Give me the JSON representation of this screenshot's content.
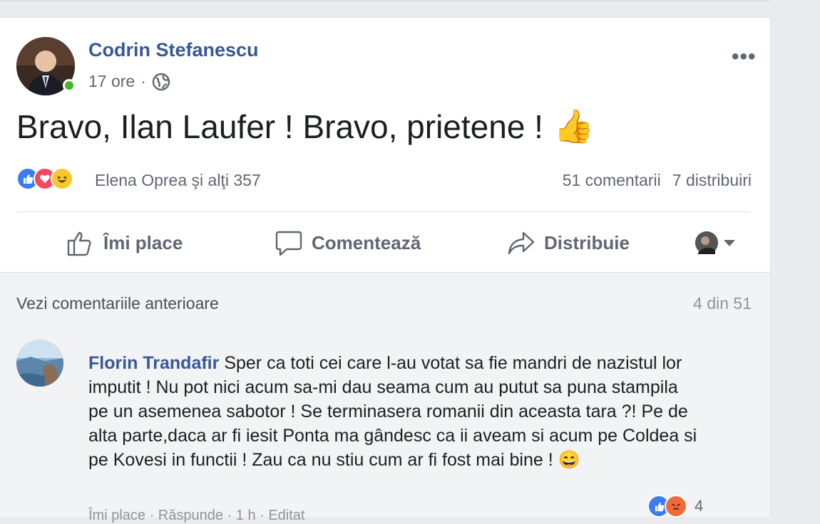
{
  "post": {
    "author": "Codrin Stefanescu",
    "time": "17 ore",
    "separator": "·",
    "text": "Bravo, Ilan Laufer ! Bravo, prietene !",
    "emoji": "👍",
    "more_label": "•••",
    "reactions": {
      "summary": "Elena Oprea şi alţi 357",
      "types": [
        "like-icon",
        "love-icon",
        "haha-icon"
      ]
    },
    "comments_count": "51 comentarii",
    "shares_count": "7 distribuiri"
  },
  "actions": {
    "like": "Îmi place",
    "comment": "Comentează",
    "share": "Distribuie"
  },
  "comments": {
    "view_previous": "Vezi comentariile anterioare",
    "page": "4 din 51",
    "items": [
      {
        "author": "Florin Trandafir",
        "text": "Sper ca toti cei care l-au votat sa fie mandri de nazistul lor imputit ! Nu pot nici acum sa-mi dau seama cum au putut sa puna stampila pe un asemenea sabotor ! Se terminasera romanii din aceasta tara ?! Pe de alta parte,daca ar fi iesit Ponta ma gândesc ca ii aveam si acum pe Coldea si pe Kovesi in functii ! Zau ca nu stiu cum ar fi fost mai bine !",
        "emoji": "😄",
        "reaction_count": "4",
        "footer": "Îmi place · Răspunde · 1 h · Editat"
      }
    ]
  },
  "colors": {
    "link_blue": "#385898",
    "online_green": "#42b72a",
    "like_blue": "#3b7df0",
    "love_red": "#f2475f",
    "haha_yellow": "#f7c630"
  }
}
